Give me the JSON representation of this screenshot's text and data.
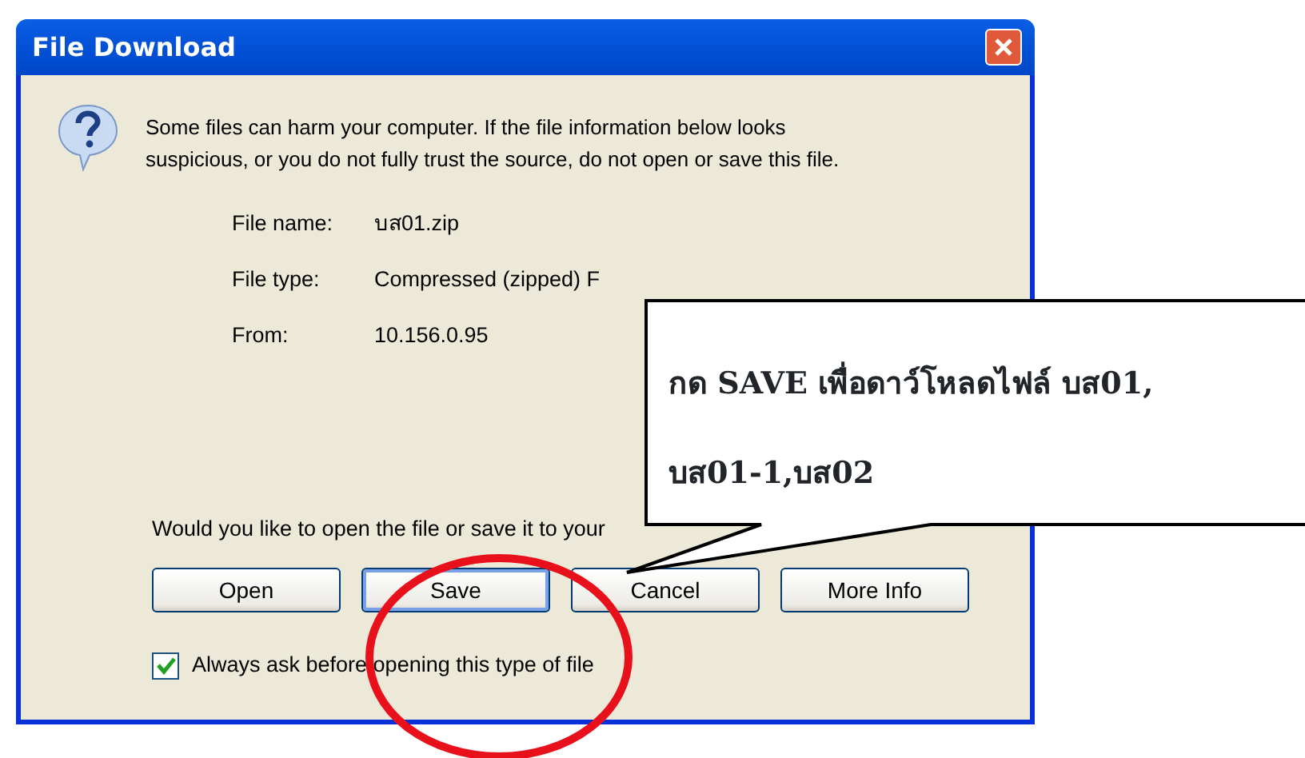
{
  "window": {
    "title": "File Download"
  },
  "message": "Some files can harm your computer. If the file information below looks suspicious, or you do not fully trust the source, do not open or save this file.",
  "fields": [
    {
      "label": "File name:",
      "value": "บส01.zip"
    },
    {
      "label": "File type:",
      "value": "Compressed (zipped) F"
    },
    {
      "label": "From:",
      "value": "10.156.0.95"
    }
  ],
  "question": "Would you like to open the file or save it to your",
  "buttons": [
    {
      "label": "Open",
      "default": false
    },
    {
      "label": "Save",
      "default": true
    },
    {
      "label": "Cancel",
      "default": false
    },
    {
      "label": "More Info",
      "default": false
    }
  ],
  "checkbox": {
    "label": "Always ask before opening this type of file",
    "checked": true
  },
  "callout": {
    "lines": [
      "กด **SAVE**  เพื่อดาว์โหลดไฟล์ บส01,",
      "บส01-1,บส02"
    ]
  }
}
